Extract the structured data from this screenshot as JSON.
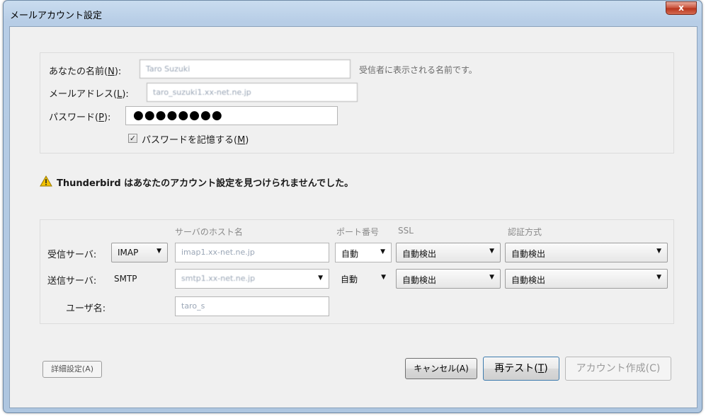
{
  "window": {
    "title": "メールアカウント設定",
    "close_label": "x"
  },
  "account": {
    "name_label": "あなたの名前(",
    "name_key": "N",
    "name_label_end": "):",
    "name_value": "Taro Suzuki",
    "name_hint": "受信者に表示される名前です。",
    "email_label": "メールアドレス(",
    "email_key": "L",
    "email_label_end": "):",
    "email_value": "taro_suzuki1.xx-net.ne.jp",
    "password_label": "パスワード(",
    "password_key": "P",
    "password_label_end": "):",
    "password_value": "●●●●●●●●",
    "remember_label": "パスワードを記憶する(",
    "remember_key": "M",
    "remember_label_end": ")",
    "remember_checked": "✓"
  },
  "warning": {
    "text": "Thunderbird はあなたのアカウント設定を見つけられませんでした。",
    "icon_color": "#f2c200"
  },
  "server": {
    "headers": {
      "host": "サーバのホスト名",
      "port": "ポート番号",
      "ssl": "SSL",
      "auth": "認証方式"
    },
    "incoming": {
      "label": "受信サーバ:",
      "protocol": "IMAP",
      "host": "imap1.xx-net.ne.jp",
      "port": "自動",
      "ssl": "自動検出",
      "auth": "自動検出"
    },
    "outgoing": {
      "label": "送信サーバ:",
      "protocol": "SMTP",
      "host": "smtp1.xx-net.ne.jp",
      "port": "自動",
      "ssl": "自動検出",
      "auth": "自動検出"
    },
    "username_label": "ユーザ名:",
    "username_value": "taro_s"
  },
  "buttons": {
    "advanced": "詳細設定(A)",
    "cancel": "キャンセル(A)",
    "retest_prefix": "再テスト(",
    "retest_key": "T",
    "retest_suffix": ")",
    "create": "アカウント作成(C)"
  }
}
